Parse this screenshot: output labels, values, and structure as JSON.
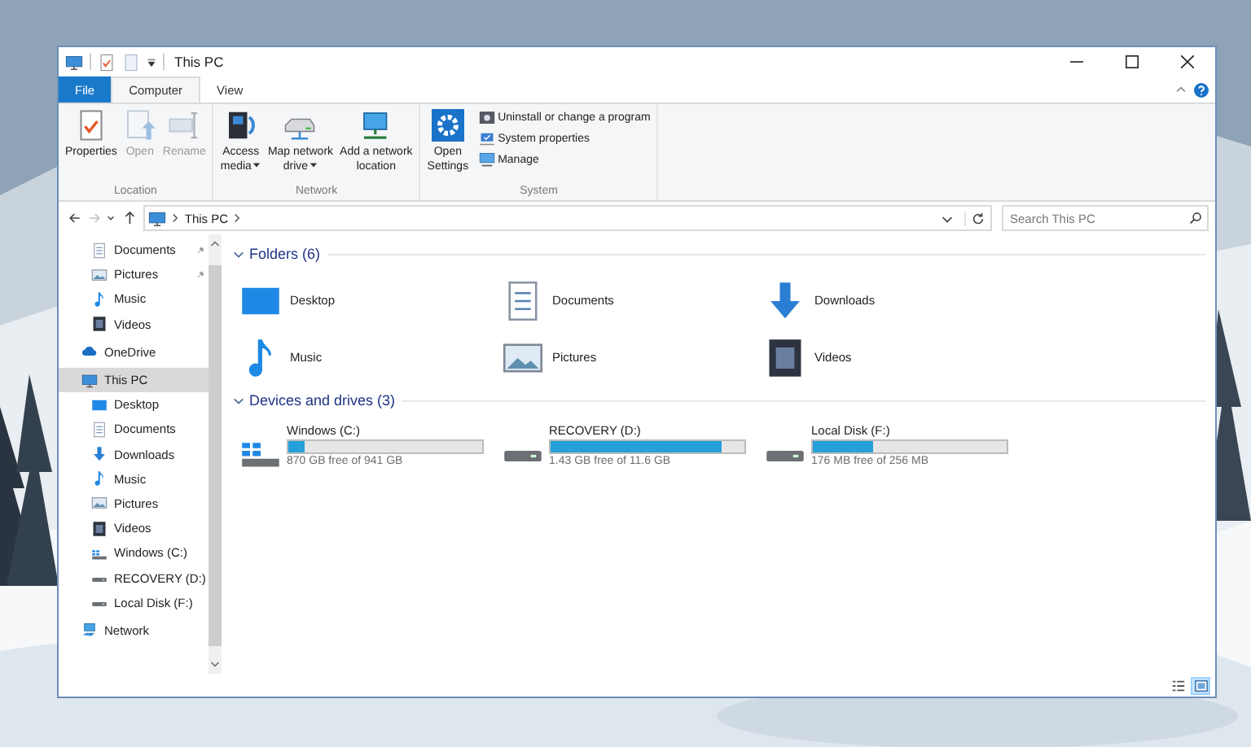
{
  "window": {
    "title": "This PC"
  },
  "ribbon": {
    "tabs": [
      {
        "label": "File",
        "kind": "file",
        "selected": false
      },
      {
        "label": "Computer",
        "kind": "tab",
        "selected": true
      },
      {
        "label": "View",
        "kind": "tab",
        "selected": false
      }
    ],
    "groups": [
      {
        "label": "Location",
        "kind": "large",
        "items": [
          {
            "lines": [
              "Properties"
            ],
            "kind": "properties",
            "disabled": false,
            "dropdown": false
          },
          {
            "lines": [
              "Open"
            ],
            "kind": "open",
            "disabled": true,
            "dropdown": false
          },
          {
            "lines": [
              "Rename"
            ],
            "kind": "rename",
            "disabled": true,
            "dropdown": false
          }
        ]
      },
      {
        "label": "Network",
        "kind": "large",
        "items": [
          {
            "lines": [
              "Access",
              "media"
            ],
            "kind": "media",
            "disabled": false,
            "dropdown": true
          },
          {
            "lines": [
              "Map network",
              "drive"
            ],
            "kind": "netdrive",
            "disabled": false,
            "dropdown": true
          },
          {
            "lines": [
              "Add a network",
              "location"
            ],
            "kind": "netloc",
            "disabled": false,
            "dropdown": false
          }
        ]
      },
      {
        "label": "System",
        "kind": "mixed",
        "items": [
          {
            "lines": [
              "Open",
              "Settings"
            ],
            "kind": "settings",
            "disabled": false,
            "dropdown": false
          }
        ],
        "small_items": [
          {
            "label": "Uninstall or change a program",
            "kind": "uninstall"
          },
          {
            "label": "System properties",
            "kind": "sysprops"
          },
          {
            "label": "Manage",
            "kind": "manage"
          }
        ]
      }
    ]
  },
  "navigation": {
    "buttons": [
      {
        "kind": "back",
        "disabled": false
      },
      {
        "kind": "forward",
        "disabled": true
      },
      {
        "kind": "recent",
        "disabled": false
      },
      {
        "kind": "up",
        "disabled": false
      }
    ],
    "path": [
      "This PC"
    ],
    "search": {
      "placeholder": "Search This PC"
    }
  },
  "nav_pane": {
    "quick_access_items": [
      {
        "label": "Documents",
        "kind": "documents",
        "pinned": true,
        "selected": false
      },
      {
        "label": "Pictures",
        "kind": "pictures",
        "pinned": true,
        "selected": false
      },
      {
        "label": "Music",
        "kind": "music",
        "pinned": false,
        "selected": false
      },
      {
        "label": "Videos",
        "kind": "videos",
        "pinned": false,
        "selected": false
      }
    ],
    "items": [
      {
        "label": "OneDrive",
        "kind": "onedrive",
        "selected": false
      },
      {
        "label": "This PC",
        "kind": "pc",
        "selected": true,
        "children": [
          {
            "label": "Desktop",
            "kind": "desktop",
            "selected": false
          },
          {
            "label": "Documents",
            "kind": "documents",
            "selected": false
          },
          {
            "label": "Downloads",
            "kind": "downloads",
            "selected": false
          },
          {
            "label": "Music",
            "kind": "music",
            "selected": false
          },
          {
            "label": "Pictures",
            "kind": "pictures",
            "selected": false
          },
          {
            "label": "Videos",
            "kind": "videos",
            "selected": false
          },
          {
            "label": "Windows (C:)",
            "kind": "windrive",
            "selected": false
          },
          {
            "label": "RECOVERY (D:)",
            "kind": "drive",
            "selected": false
          },
          {
            "label": "Local Disk (F:)",
            "kind": "drive",
            "selected": false
          }
        ]
      },
      {
        "label": "Network",
        "kind": "network",
        "selected": false
      }
    ]
  },
  "sections": [
    {
      "title": "Folders (6)",
      "kind": "folders",
      "expanded": true,
      "items": [
        {
          "label": "Desktop",
          "kind": "desktop"
        },
        {
          "label": "Documents",
          "kind": "documents"
        },
        {
          "label": "Downloads",
          "kind": "downloads"
        },
        {
          "label": "Music",
          "kind": "music"
        },
        {
          "label": "Pictures",
          "kind": "pictures"
        },
        {
          "label": "Videos",
          "kind": "videos"
        }
      ]
    },
    {
      "title": "Devices and drives (3)",
      "kind": "drives",
      "expanded": true,
      "items": [
        {
          "label": "Windows (C:)",
          "kind": "windrive",
          "level": 0.08,
          "free": "870 GB free of 941 GB"
        },
        {
          "label": "RECOVERY (D:)",
          "kind": "drive",
          "level": 0.88,
          "free": "1.43 GB free of 11.6 GB"
        },
        {
          "label": "Local Disk (F:)",
          "kind": "drive",
          "level": 0.31,
          "free": "176 MB free of 256 MB"
        }
      ]
    }
  ],
  "status_bar": {
    "views": [
      {
        "kind": "details",
        "selected": false
      },
      {
        "kind": "large_icons",
        "selected": true
      }
    ]
  }
}
